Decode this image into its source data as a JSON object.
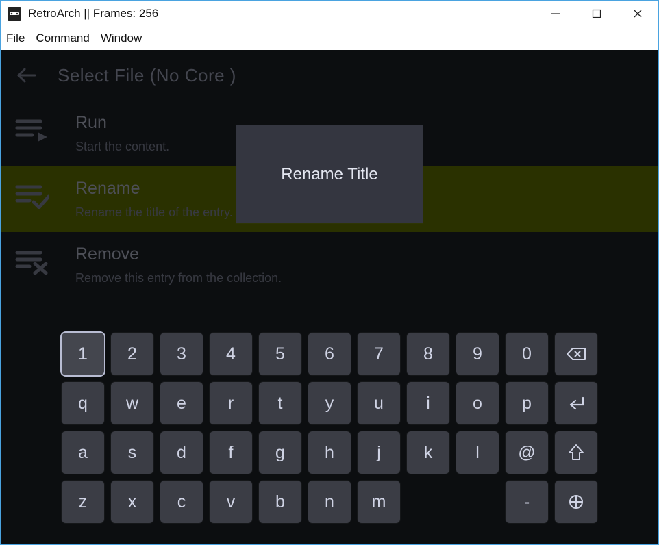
{
  "window": {
    "title": "RetroArch  || Frames: 256"
  },
  "menu": {
    "items": [
      "File",
      "Command",
      "Window"
    ]
  },
  "header": {
    "title": "Select File  (No Core )"
  },
  "list": {
    "items": [
      {
        "title": "Run",
        "sub": "Start the content."
      },
      {
        "title": "Rename",
        "sub": "Rename the title of the entry."
      },
      {
        "title": "Remove",
        "sub": "Remove this entry from the collection."
      }
    ]
  },
  "popup": {
    "text": "Rename Title"
  },
  "keyboard": {
    "rows": [
      [
        "1",
        "2",
        "3",
        "4",
        "5",
        "6",
        "7",
        "8",
        "9",
        "0",
        "__back"
      ],
      [
        "q",
        "w",
        "e",
        "r",
        "t",
        "y",
        "u",
        "i",
        "o",
        "p",
        "__enter"
      ],
      [
        "a",
        "s",
        "d",
        "f",
        "g",
        "h",
        "j",
        "k",
        "l",
        "@",
        "__shift"
      ],
      [
        "z",
        "x",
        "c",
        "v",
        "b",
        "n",
        "m",
        "",
        "",
        "-",
        "__sym"
      ]
    ],
    "highlight": {
      "row": 0,
      "col": 0
    }
  }
}
